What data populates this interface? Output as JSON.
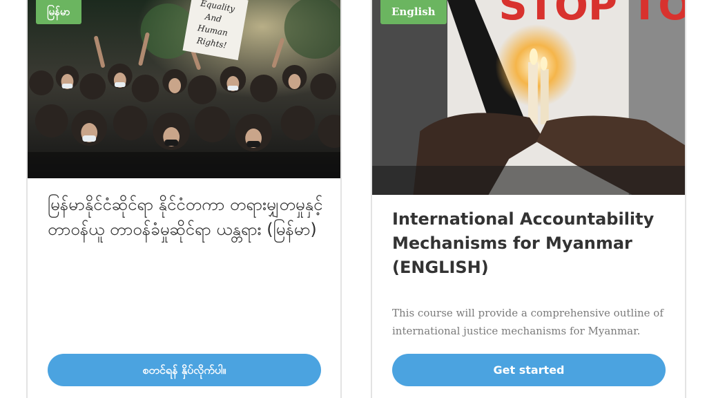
{
  "courses": [
    {
      "language_badge": "မြန်မာ",
      "image_icon": "protest-crowd-photo",
      "title": "မြန်မာနိုင်ငံဆိုင်ရာ နိုင်ငံတကာ တရားမျှတမှုနှင့် တာဝန်ယူ တာဝန်ခံမှုဆိုင်ရာ ယန္တရား (မြန်မာ)",
      "description": "",
      "button_label": "စတင်ရန် နှိပ်လိုက်ပါ။"
    },
    {
      "language_badge": "English",
      "image_icon": "candle-vigil-photo",
      "image_text": "STOP TORTURE",
      "title": "International Accountability Mechanisms for Myanmar (ENGLISH)",
      "description": "This course will provide a comprehensive outline of international justice mechanisms for Myanmar.",
      "button_label": "Get started"
    }
  ],
  "colors": {
    "badge_green": "#6bb560",
    "button_blue": "#4ba3e0",
    "title_text": "#333333",
    "desc_text": "#7a7a7a"
  }
}
